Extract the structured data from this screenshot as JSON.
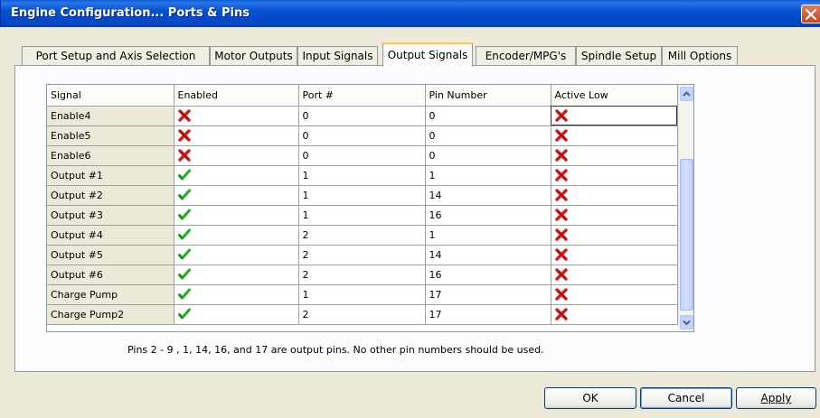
{
  "window": {
    "title": "Engine Configuration... Ports & Pins"
  },
  "tabs": [
    {
      "label": "Port Setup and Axis Selection",
      "active": false
    },
    {
      "label": "Motor Outputs",
      "active": false
    },
    {
      "label": "Input Signals",
      "active": false
    },
    {
      "label": "Output Signals",
      "active": true
    },
    {
      "label": "Encoder/MPG's",
      "active": false
    },
    {
      "label": "Spindle Setup",
      "active": false
    },
    {
      "label": "Mill Options",
      "active": false
    }
  ],
  "grid": {
    "columns": [
      "Signal",
      "Enabled",
      "Port #",
      "Pin Number",
      "Active Low"
    ],
    "rows": [
      {
        "signal": "Enable4",
        "enabled": false,
        "port": "0",
        "pin": "0",
        "active_low": false
      },
      {
        "signal": "Enable5",
        "enabled": false,
        "port": "0",
        "pin": "0",
        "active_low": false
      },
      {
        "signal": "Enable6",
        "enabled": false,
        "port": "0",
        "pin": "0",
        "active_low": false
      },
      {
        "signal": "Output #1",
        "enabled": true,
        "port": "1",
        "pin": "1",
        "active_low": false
      },
      {
        "signal": "Output #2",
        "enabled": true,
        "port": "1",
        "pin": "14",
        "active_low": false
      },
      {
        "signal": "Output #3",
        "enabled": true,
        "port": "1",
        "pin": "16",
        "active_low": false
      },
      {
        "signal": "Output #4",
        "enabled": true,
        "port": "2",
        "pin": "1",
        "active_low": false
      },
      {
        "signal": "Output #5",
        "enabled": true,
        "port": "2",
        "pin": "14",
        "active_low": false
      },
      {
        "signal": "Output #6",
        "enabled": true,
        "port": "2",
        "pin": "16",
        "active_low": false
      },
      {
        "signal": "Charge Pump",
        "enabled": true,
        "port": "1",
        "pin": "17",
        "active_low": false
      },
      {
        "signal": "Charge Pump2",
        "enabled": true,
        "port": "2",
        "pin": "17",
        "active_low": false
      }
    ],
    "icons": {
      "true": "green-check-icon",
      "false": "red-x-icon"
    }
  },
  "note": "Pins 2 - 9 , 1, 14, 16, and 17 are output pins. No  other pin numbers should be used.",
  "buttons": {
    "ok": "OK",
    "cancel": "Cancel",
    "apply": "Apply"
  },
  "colors": {
    "titlebar": "#0348C6",
    "check": "#1DB21D",
    "x": "#D81818"
  }
}
